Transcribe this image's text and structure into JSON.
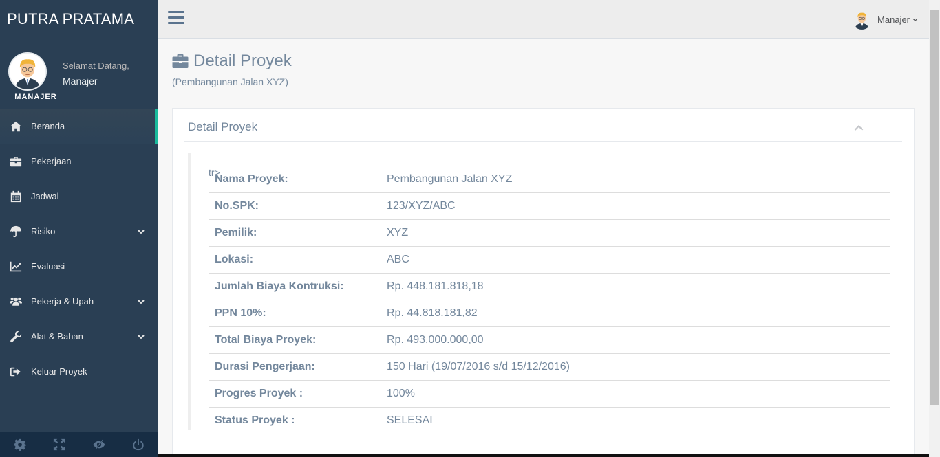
{
  "brand": "PUTRA PRATAMA",
  "profile": {
    "welcome": "Selamat Datang,",
    "name": "Manajer",
    "role": "MANAJER"
  },
  "nav": [
    {
      "label": "Beranda",
      "icon": "home-icon",
      "active": true
    },
    {
      "label": "Pekerjaan",
      "icon": "briefcase-icon"
    },
    {
      "label": "Jadwal",
      "icon": "calendar-icon"
    },
    {
      "label": "Risiko",
      "icon": "umbrella-icon",
      "submenu": true
    },
    {
      "label": "Evaluasi",
      "icon": "line-chart-icon"
    },
    {
      "label": "Pekerja & Upah",
      "icon": "users-icon",
      "submenu": true
    },
    {
      "label": "Alat & Bahan",
      "icon": "wrench-icon",
      "submenu": true
    },
    {
      "label": "Keluar Proyek",
      "icon": "sign-out-icon"
    }
  ],
  "topnav": {
    "user": "Manajer"
  },
  "page": {
    "title": "Detail Proyek",
    "subtitle": "(Pembangunan Jalan XYZ)"
  },
  "panel": {
    "title": "Detail Proyek",
    "stray_text": "tr>",
    "rows": [
      {
        "label": "Nama Proyek:",
        "value": "Pembangunan Jalan XYZ"
      },
      {
        "label": "No.SPK:",
        "value": "123/XYZ/ABC"
      },
      {
        "label": "Pemilik:",
        "value": "XYZ"
      },
      {
        "label": "Lokasi:",
        "value": "ABC"
      },
      {
        "label": "Jumlah Biaya Kontruksi:",
        "value": "Rp. 448.181.818,18"
      },
      {
        "label": "PPN 10%:",
        "value": "Rp. 44.818.181,82"
      },
      {
        "label": "Total Biaya Proyek:",
        "value": "Rp. 493.000.000,00"
      },
      {
        "label": "Durasi Pengerjaan:",
        "value": "150 Hari (19/07/2016 s/d 15/12/2016)"
      },
      {
        "label": "Progres Proyek :",
        "value": "100%"
      },
      {
        "label": "Status Proyek :",
        "value": "SELESAI"
      }
    ]
  },
  "colors": {
    "sidebar": "#2a3f54",
    "accent": "#1abb9c",
    "text": "#73879c"
  }
}
